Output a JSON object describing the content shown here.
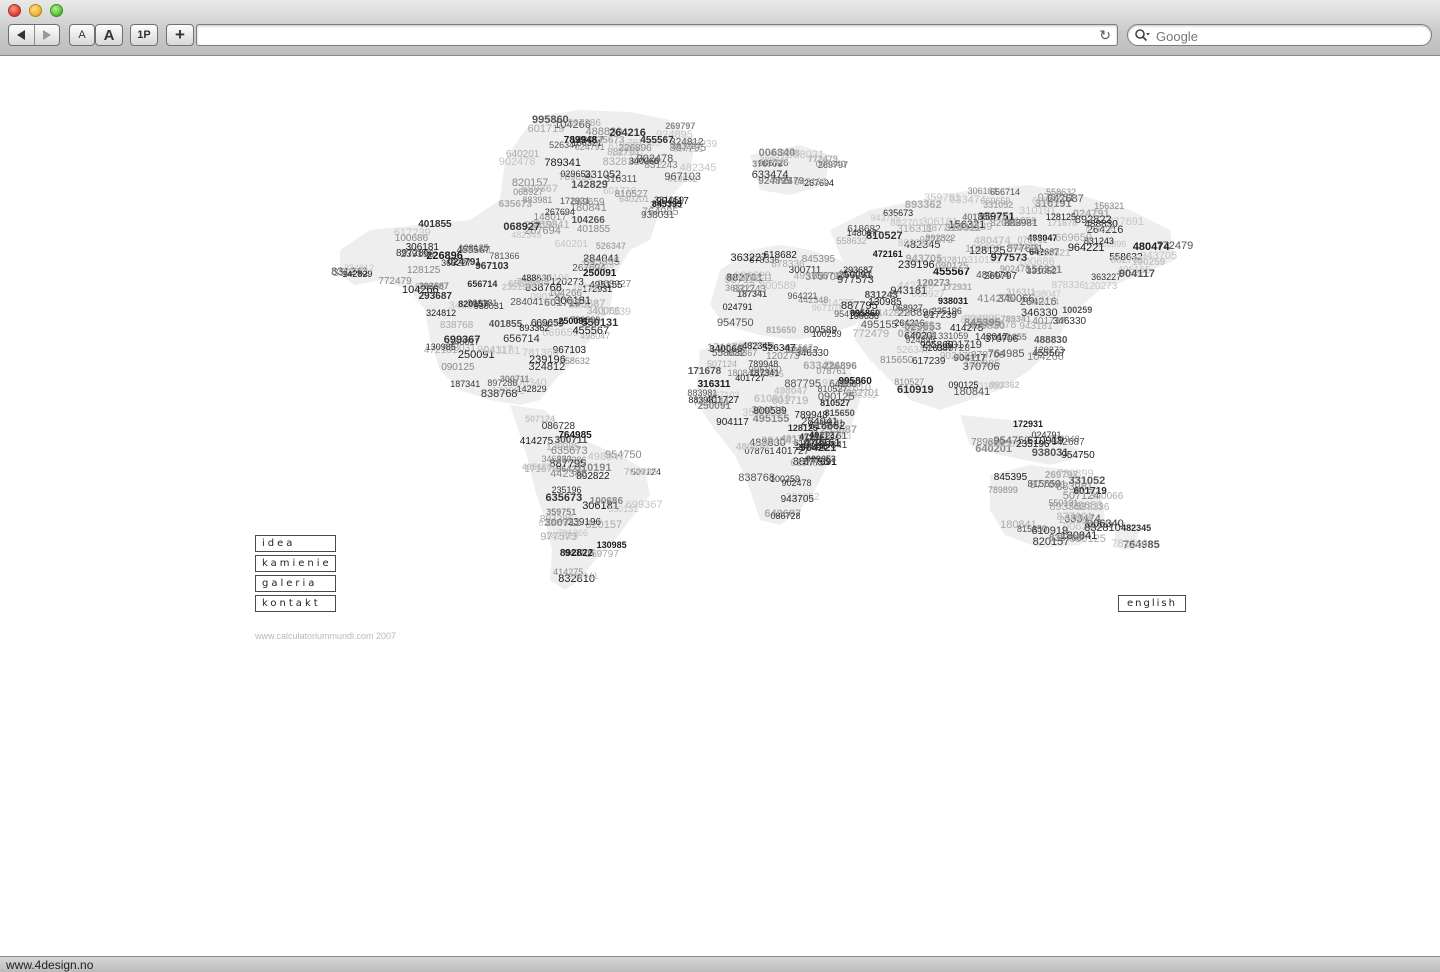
{
  "browser": {
    "font_small_label": "A",
    "font_large_label": "A",
    "onepassword_label": "1P",
    "add_label": "+",
    "url_value": "",
    "search_placeholder": "Google",
    "status_text": "www.4design.no"
  },
  "nav": {
    "items": [
      {
        "label": "idea"
      },
      {
        "label": "kamienie"
      },
      {
        "label": "galeria"
      },
      {
        "label": "kontakt"
      }
    ],
    "language_label": "english"
  },
  "footer": {
    "copyright": "www.calculatoriummundi.com 2007"
  },
  "map_numbers": [
    "180841",
    "401727",
    "029653",
    "120273",
    "455567",
    "887795",
    "346330",
    "306181",
    "488830",
    "618682",
    "967103",
    "090125",
    "601719",
    "838768",
    "472161",
    "526347",
    "006340",
    "495155",
    "235196",
    "938031",
    "815650",
    "507124",
    "104266",
    "882701",
    "370706",
    "100686",
    "964221",
    "924895",
    "078761",
    "633474",
    "781366",
    "331052",
    "340066",
    "300711",
    "878336",
    "226896",
    "954750",
    "640201",
    "142829",
    "100259",
    "617239",
    "172931",
    "024791",
    "772479",
    "068927",
    "171678",
    "310191",
    "800589",
    "977573",
    "893362",
    "482345",
    "883981",
    "550131",
    "904117",
    "401855",
    "845395",
    "267694",
    "831243",
    "363227",
    "498047",
    "832810",
    "789948",
    "480474",
    "820157",
    "324812",
    "610919",
    "902478",
    "810527",
    "943705",
    "669659",
    "239196",
    "148017",
    "995860",
    "130985",
    "635673",
    "642687",
    "293687",
    "128125",
    "156321",
    "699367",
    "764985",
    "086728",
    "789341",
    "558632",
    "414275",
    "877691",
    "284041",
    "892822",
    "897286",
    "316311",
    "269797",
    "943181",
    "331059",
    "656714",
    "250091",
    "789899",
    "359751",
    "264216",
    "187341",
    "442348"
  ]
}
